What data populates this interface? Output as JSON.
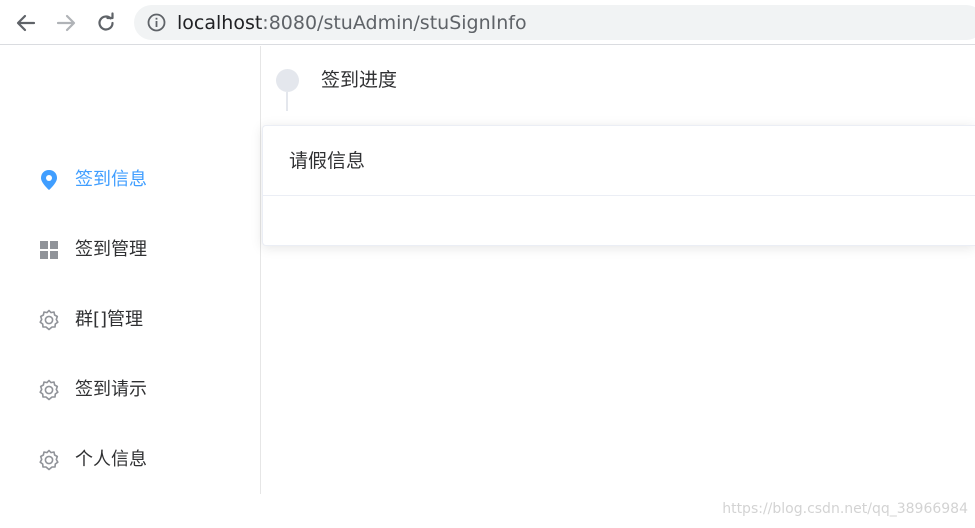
{
  "browser": {
    "url_host": "localhost",
    "url_path": ":8080/stuAdmin/stuSignInfo",
    "icons": {
      "back": "arrow-left-icon",
      "forward": "arrow-right-icon",
      "reload": "reload-icon",
      "site_info": "info-icon"
    }
  },
  "sidebar": {
    "items": [
      {
        "label": "签到信息",
        "icon": "location-pin-icon",
        "active": true
      },
      {
        "label": "签到管理",
        "icon": "grid-icon",
        "active": false
      },
      {
        "label": "群[]管理",
        "icon": "gear-icon",
        "active": false
      },
      {
        "label": "签到请示",
        "icon": "gear-icon",
        "active": false
      },
      {
        "label": "个人信息",
        "icon": "gear-icon",
        "active": false
      }
    ]
  },
  "main": {
    "timeline": {
      "title": "签到进度"
    },
    "card": {
      "title": "请假信息"
    }
  },
  "watermark": "https://blog.csdn.net/qq_38966984",
  "colors": {
    "accent": "#409eff",
    "text": "#303133",
    "muted_icon": "#909399",
    "divider": "#e6e6e6",
    "address_bar": "#f1f3f4"
  }
}
